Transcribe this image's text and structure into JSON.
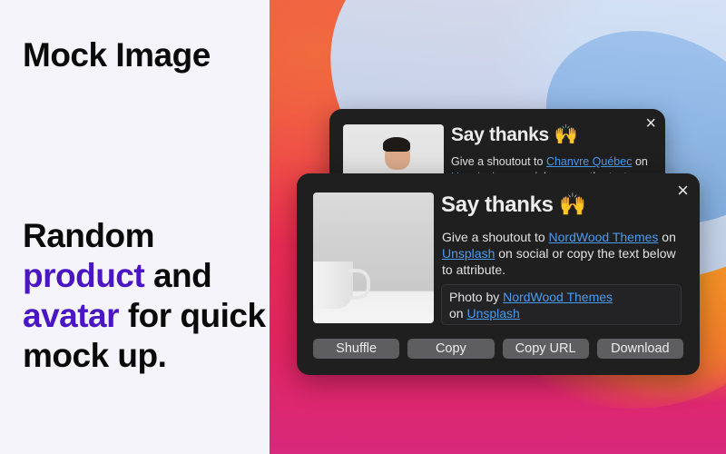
{
  "promo": {
    "app_title": "Mock Image",
    "tagline": {
      "part1": "Random",
      "highlight1": "product",
      "part2": "and",
      "highlight2": "avatar",
      "part3": "for quick mock up."
    },
    "highlight_color": "#4a16c4"
  },
  "back_card": {
    "title": "Say thanks",
    "emoji": "🙌",
    "close_icon": "×",
    "image": "avatar-photo",
    "desc_prefix": "Give a shoutout to",
    "author": "Chanvre Québec",
    "desc_suffix": "on",
    "desc_line2_link": "Unsplash",
    "desc_line2_rest": "on social or copy the text"
  },
  "front_card": {
    "title": "Say thanks",
    "emoji": "🙌",
    "close_icon": "×",
    "image": "product-photo-mug",
    "desc_prefix": "Give a shoutout to",
    "author": "NordWood Themes",
    "desc_mid": "on",
    "platform": "Unsplash",
    "desc_suffix": "on social or copy the text below to attribute.",
    "attribution": {
      "prefix": "Photo by",
      "author": "NordWood Themes",
      "mid": "on",
      "platform": "Unsplash"
    },
    "buttons": [
      "Shuffle",
      "Copy",
      "Copy URL",
      "Download"
    ]
  },
  "colors": {
    "link": "#4a9bf0",
    "card_bg": "#1f1f20",
    "button_bg": "#5e5e60"
  }
}
